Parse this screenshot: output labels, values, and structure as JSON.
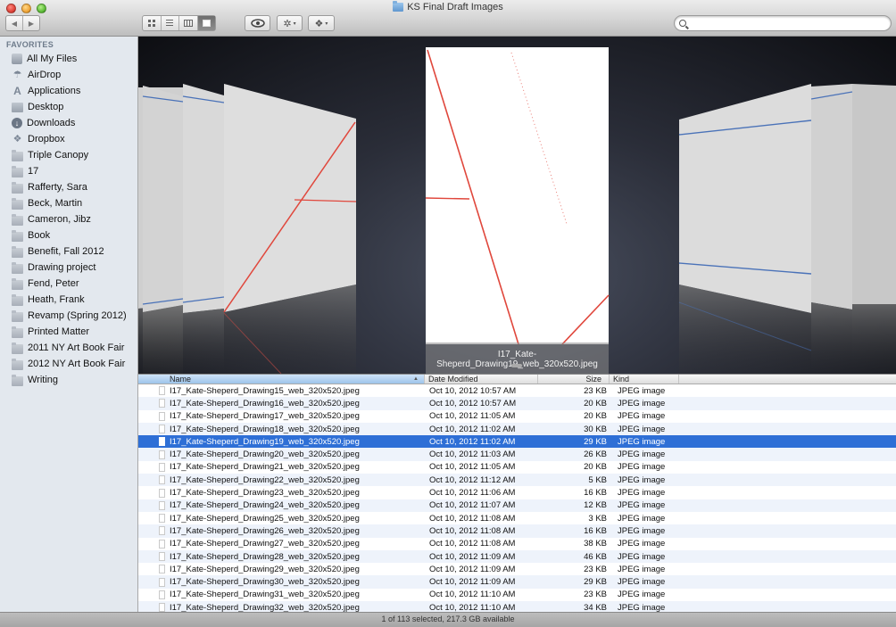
{
  "window": {
    "title": "KS Final Draft Images"
  },
  "toolbar": {
    "back_label": "◀",
    "forward_label": "▶",
    "view_modes": [
      "icon",
      "list",
      "column",
      "cover-flow"
    ],
    "active_view": "cover-flow",
    "quicklook_glyph": "👁",
    "action_glyph": "✲",
    "dropbox_glyph": "❖",
    "caret": "▾",
    "search": {
      "value": "",
      "placeholder": ""
    }
  },
  "sidebar": {
    "heading": "FAVORITES",
    "items": [
      {
        "label": "All My Files",
        "icon": "all-my-files-icon"
      },
      {
        "label": "AirDrop",
        "icon": "airdrop-icon"
      },
      {
        "label": "Applications",
        "icon": "applications-icon"
      },
      {
        "label": "Desktop",
        "icon": "desktop-icon"
      },
      {
        "label": "Downloads",
        "icon": "downloads-icon"
      },
      {
        "label": "Dropbox",
        "icon": "dropbox-icon"
      },
      {
        "label": "Triple Canopy",
        "icon": "folder-icon"
      },
      {
        "label": "17",
        "icon": "folder-icon"
      },
      {
        "label": "Rafferty, Sara",
        "icon": "folder-icon"
      },
      {
        "label": "Beck, Martin",
        "icon": "folder-icon"
      },
      {
        "label": "Cameron, Jibz",
        "icon": "folder-icon"
      },
      {
        "label": "Book",
        "icon": "folder-icon"
      },
      {
        "label": "Benefit, Fall 2012",
        "icon": "folder-icon"
      },
      {
        "label": "Drawing project",
        "icon": "folder-icon"
      },
      {
        "label": "Fend, Peter",
        "icon": "folder-icon"
      },
      {
        "label": "Heath, Frank",
        "icon": "folder-icon"
      },
      {
        "label": "Revamp (Spring 2012)",
        "icon": "folder-icon"
      },
      {
        "label": "Printed Matter",
        "icon": "folder-icon"
      },
      {
        "label": "2011 NY Art Book Fair",
        "icon": "folder-icon"
      },
      {
        "label": "2012 NY Art Book Fair",
        "icon": "folder-icon"
      },
      {
        "label": "Writing",
        "icon": "folder-icon"
      }
    ]
  },
  "coverflow": {
    "caption": "I17_Kate-Sheperd_Drawing19_web_320x520.jpeg"
  },
  "list": {
    "columns": {
      "name": "Name",
      "date": "Date Modified",
      "size": "Size",
      "kind": "Kind"
    },
    "sort_indicator": "▲",
    "selected_index": 4,
    "rows": [
      {
        "name": "I17_Kate-Sheperd_Drawing15_web_320x520.jpeg",
        "date": "Oct 10, 2012 10:57 AM",
        "size": "23 KB",
        "kind": "JPEG image"
      },
      {
        "name": "I17_Kate-Sheperd_Drawing16_web_320x520.jpeg",
        "date": "Oct 10, 2012 10:57 AM",
        "size": "20 KB",
        "kind": "JPEG image"
      },
      {
        "name": "I17_Kate-Sheperd_Drawing17_web_320x520.jpeg",
        "date": "Oct 10, 2012 11:05 AM",
        "size": "20 KB",
        "kind": "JPEG image"
      },
      {
        "name": "I17_Kate-Sheperd_Drawing18_web_320x520.jpeg",
        "date": "Oct 10, 2012 11:02 AM",
        "size": "30 KB",
        "kind": "JPEG image"
      },
      {
        "name": "I17_Kate-Sheperd_Drawing19_web_320x520.jpeg",
        "date": "Oct 10, 2012 11:02 AM",
        "size": "29 KB",
        "kind": "JPEG image"
      },
      {
        "name": "I17_Kate-Sheperd_Drawing20_web_320x520.jpeg",
        "date": "Oct 10, 2012 11:03 AM",
        "size": "26 KB",
        "kind": "JPEG image"
      },
      {
        "name": "I17_Kate-Sheperd_Drawing21_web_320x520.jpeg",
        "date": "Oct 10, 2012 11:05 AM",
        "size": "20 KB",
        "kind": "JPEG image"
      },
      {
        "name": "I17_Kate-Sheperd_Drawing22_web_320x520.jpeg",
        "date": "Oct 10, 2012 11:12 AM",
        "size": "5 KB",
        "kind": "JPEG image"
      },
      {
        "name": "I17_Kate-Sheperd_Drawing23_web_320x520.jpeg",
        "date": "Oct 10, 2012 11:06 AM",
        "size": "16 KB",
        "kind": "JPEG image"
      },
      {
        "name": "I17_Kate-Sheperd_Drawing24_web_320x520.jpeg",
        "date": "Oct 10, 2012 11:07 AM",
        "size": "12 KB",
        "kind": "JPEG image"
      },
      {
        "name": "I17_Kate-Sheperd_Drawing25_web_320x520.jpeg",
        "date": "Oct 10, 2012 11:08 AM",
        "size": "3 KB",
        "kind": "JPEG image"
      },
      {
        "name": "I17_Kate-Sheperd_Drawing26_web_320x520.jpeg",
        "date": "Oct 10, 2012 11:08 AM",
        "size": "16 KB",
        "kind": "JPEG image"
      },
      {
        "name": "I17_Kate-Sheperd_Drawing27_web_320x520.jpeg",
        "date": "Oct 10, 2012 11:08 AM",
        "size": "38 KB",
        "kind": "JPEG image"
      },
      {
        "name": "I17_Kate-Sheperd_Drawing28_web_320x520.jpeg",
        "date": "Oct 10, 2012 11:09 AM",
        "size": "46 KB",
        "kind": "JPEG image"
      },
      {
        "name": "I17_Kate-Sheperd_Drawing29_web_320x520.jpeg",
        "date": "Oct 10, 2012 11:09 AM",
        "size": "23 KB",
        "kind": "JPEG image"
      },
      {
        "name": "I17_Kate-Sheperd_Drawing30_web_320x520.jpeg",
        "date": "Oct 10, 2012 11:09 AM",
        "size": "29 KB",
        "kind": "JPEG image"
      },
      {
        "name": "I17_Kate-Sheperd_Drawing31_web_320x520.jpeg",
        "date": "Oct 10, 2012 11:10 AM",
        "size": "23 KB",
        "kind": "JPEG image"
      },
      {
        "name": "I17_Kate-Sheperd_Drawing32_web_320x520.jpeg",
        "date": "Oct 10, 2012 11:10 AM",
        "size": "34 KB",
        "kind": "JPEG image"
      }
    ]
  },
  "statusbar": {
    "text": "1 of 113 selected, 217.3 GB available"
  },
  "colors": {
    "selection": "#2e6fd6",
    "drawing_red": "#e0473c",
    "drawing_blue": "#4a72b8"
  }
}
